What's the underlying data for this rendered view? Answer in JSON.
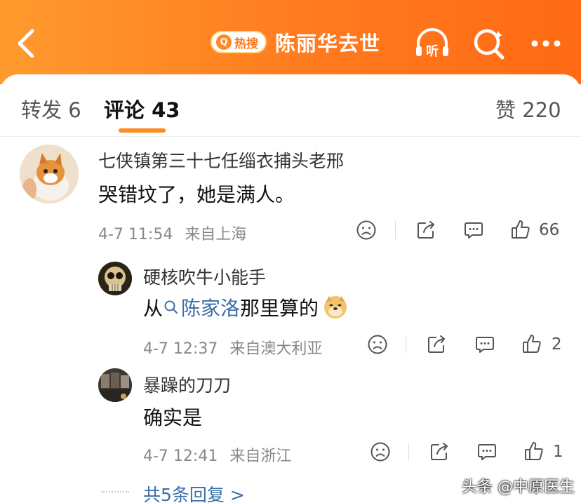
{
  "header": {
    "hot_badge": "热搜",
    "title": "陈丽华去世",
    "accent": "#ff7a1f"
  },
  "tabs": {
    "repost": "转发 6",
    "comments": "评论 43",
    "likes": "赞 220"
  },
  "icons": [
    "chevron-left-icon",
    "listen-icon",
    "search-icon",
    "more-icon",
    "emoji-sad-icon",
    "share-icon",
    "comment-icon",
    "like-icon"
  ],
  "listen_label": "听",
  "comments": [
    {
      "user": "七侠镇第三十七任缁衣捕头老邢",
      "text": "哭错坟了，她是满人。",
      "time": "4-7 11:54",
      "location": "来自上海",
      "likes": "66"
    },
    {
      "user": "硬核吹牛小能手",
      "text_prefix": "从",
      "topic": "陈家洛",
      "text_suffix": "那里算的",
      "time": "4-7 12:37",
      "location": "来自澳大利亚",
      "likes": "2"
    },
    {
      "user": "暴躁的刀刀",
      "text": "确实是",
      "time": "4-7 12:41",
      "location": "来自浙江",
      "likes": "1"
    }
  ],
  "more_replies": "共5条回复 >",
  "watermark": "头条 @中原医生"
}
